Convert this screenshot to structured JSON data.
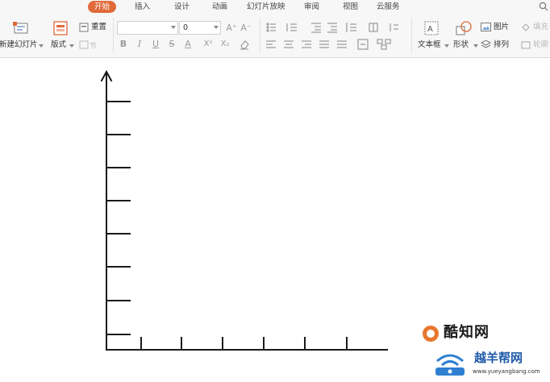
{
  "ribbon": {
    "tabs": [
      {
        "label": "开始",
        "active": true
      },
      {
        "label": "插入",
        "active": false
      },
      {
        "label": "设计",
        "active": false
      },
      {
        "label": "动画",
        "active": false
      },
      {
        "label": "幻灯片放映",
        "active": false
      },
      {
        "label": "审阅",
        "active": false
      },
      {
        "label": "视图",
        "active": false
      },
      {
        "label": "云服务",
        "active": false
      }
    ],
    "new_slide_label": "新建幻灯片",
    "layout_label": "版式",
    "reset_label": "重置",
    "font_name_value": "",
    "font_size_value": "0",
    "textbox_label": "文本框",
    "shape_label": "形状",
    "picture_label": "图片",
    "arrange_label": "排列",
    "fill_label": "填充",
    "outline_label": "轮廓",
    "font_glyphs": {
      "bold": "B",
      "italic": "I",
      "underline": "U",
      "strike": "S",
      "color": "A",
      "superscript": "X²",
      "subscript": "X₂",
      "grow": "A⁺",
      "shrink": "A⁻"
    },
    "colors": {
      "active_tab": "#e06a3a",
      "ribbon_bg": "#f7f7f7"
    }
  },
  "watermark": {
    "brand_1": "酷知网",
    "brand_2": "越羊帮网",
    "url": "www.yueyangbang.com"
  }
}
